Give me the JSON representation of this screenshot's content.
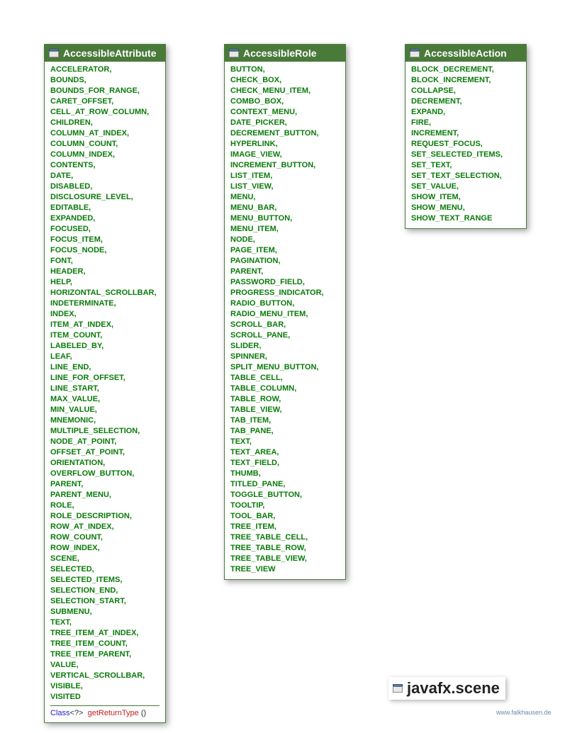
{
  "panels": {
    "attribute": {
      "title": "AccessibleAttribute",
      "items": [
        "ACCELERATOR",
        "BOUNDS",
        "BOUNDS_FOR_RANGE",
        "CARET_OFFSET",
        "CELL_AT_ROW_COLUMN",
        "CHILDREN",
        "COLUMN_AT_INDEX",
        "COLUMN_COUNT",
        "COLUMN_INDEX",
        "CONTENTS",
        "DATE",
        "DISABLED",
        "DISCLOSURE_LEVEL",
        "EDITABLE",
        "EXPANDED",
        "FOCUSED",
        "FOCUS_ITEM",
        "FOCUS_NODE",
        "FONT",
        "HEADER",
        "HELP",
        "HORIZONTAL_SCROLLBAR",
        "INDETERMINATE",
        "INDEX",
        "ITEM_AT_INDEX",
        "ITEM_COUNT",
        "LABELED_BY",
        "LEAF",
        "LINE_END",
        "LINE_FOR_OFFSET",
        "LINE_START",
        "MAX_VALUE",
        "MIN_VALUE",
        "MNEMONIC",
        "MULTIPLE_SELECTION",
        "NODE_AT_POINT",
        "OFFSET_AT_POINT",
        "ORIENTATION",
        "OVERFLOW_BUTTON",
        "PARENT",
        "PARENT_MENU",
        "ROLE",
        "ROLE_DESCRIPTION",
        "ROW_AT_INDEX",
        "ROW_COUNT",
        "ROW_INDEX",
        "SCENE",
        "SELECTED",
        "SELECTED_ITEMS",
        "SELECTION_END",
        "SELECTION_START",
        "SUBMENU",
        "TEXT",
        "TREE_ITEM_AT_INDEX",
        "TREE_ITEM_COUNT",
        "TREE_ITEM_PARENT",
        "VALUE",
        "VERTICAL_SCROLLBAR",
        "VISIBLE",
        "VISITED"
      ],
      "method": {
        "class": "Class",
        "generic": "<?>",
        "name": "getReturnType",
        "parens": "()"
      }
    },
    "role": {
      "title": "AccessibleRole",
      "items": [
        "BUTTON",
        "CHECK_BOX",
        "CHECK_MENU_ITEM",
        "COMBO_BOX",
        "CONTEXT_MENU",
        "DATE_PICKER",
        "DECREMENT_BUTTON",
        "HYPERLINK",
        "IMAGE_VIEW",
        "INCREMENT_BUTTON",
        "LIST_ITEM",
        "LIST_VIEW",
        "MENU",
        "MENU_BAR",
        "MENU_BUTTON",
        "MENU_ITEM",
        "NODE",
        "PAGE_ITEM",
        "PAGINATION",
        "PARENT",
        "PASSWORD_FIELD",
        "PROGRESS_INDICATOR",
        "RADIO_BUTTON",
        "RADIO_MENU_ITEM",
        "SCROLL_BAR",
        "SCROLL_PANE",
        "SLIDER",
        "SPINNER",
        "SPLIT_MENU_BUTTON",
        "TABLE_CELL",
        "TABLE_COLUMN",
        "TABLE_ROW",
        "TABLE_VIEW",
        "TAB_ITEM",
        "TAB_PANE",
        "TEXT",
        "TEXT_AREA",
        "TEXT_FIELD",
        "THUMB",
        "TITLED_PANE",
        "TOGGLE_BUTTON",
        "TOOLTIP",
        "TOOL_BAR",
        "TREE_ITEM",
        "TREE_TABLE_CELL",
        "TREE_TABLE_ROW",
        "TREE_TABLE_VIEW",
        "TREE_VIEW"
      ]
    },
    "action": {
      "title": "AccessibleAction",
      "items": [
        "BLOCK_DECREMENT",
        "BLOCK_INCREMENT",
        "COLLAPSE",
        "DECREMENT",
        "EXPAND",
        "FIRE",
        "INCREMENT",
        "REQUEST_FOCUS",
        "SET_SELECTED_ITEMS",
        "SET_TEXT",
        "SET_TEXT_SELECTION",
        "SET_VALUE",
        "SHOW_ITEM",
        "SHOW_MENU",
        "SHOW_TEXT_RANGE"
      ]
    }
  },
  "package_name": "javafx.scene",
  "watermark": "www.falkhausen.de"
}
